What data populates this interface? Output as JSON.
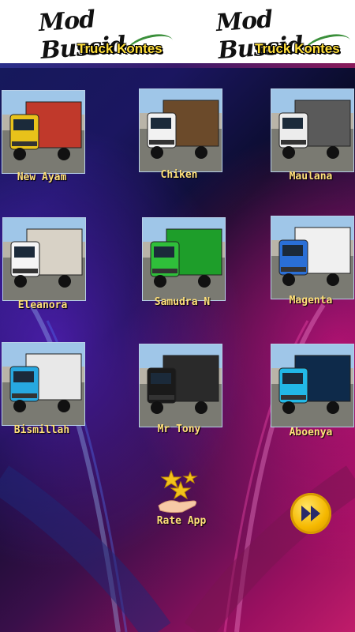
{
  "header": {
    "banners": [
      {
        "title": "Mod Bussid",
        "subtitle": "Truck Kontes"
      },
      {
        "title": "Mod Bussid",
        "subtitle": "Truck Kontes"
      }
    ]
  },
  "trucks": [
    {
      "label": "New Ayam",
      "cab_color": "#e8c21a",
      "body_color": "#c0392b"
    },
    {
      "label": "Chiken",
      "cab_color": "#f2f2f2",
      "body_color": "#6b4a2a"
    },
    {
      "label": "Maulana",
      "cab_color": "#ececec",
      "body_color": "#5a5a5a"
    },
    {
      "label": "Eleanora",
      "cab_color": "#f5f5f5",
      "body_color": "#d8d2c6"
    },
    {
      "label": "Samudra N",
      "cab_color": "#2fbf3a",
      "body_color": "#1e9e2a"
    },
    {
      "label": "Magenta",
      "cab_color": "#2a6fd6",
      "body_color": "#f0f0f0"
    },
    {
      "label": "Bismillah",
      "cab_color": "#27a8e0",
      "body_color": "#e8e8e8"
    },
    {
      "label": "Mr Tony",
      "cab_color": "#1a1a1a",
      "body_color": "#2a2a2a"
    },
    {
      "label": "Aboenya",
      "cab_color": "#22b8e6",
      "body_color": "#0e2a4a"
    }
  ],
  "rate": {
    "label": "Rate App"
  },
  "next": {
    "icon": "fast-forward-icon",
    "color": "#f5b800"
  }
}
